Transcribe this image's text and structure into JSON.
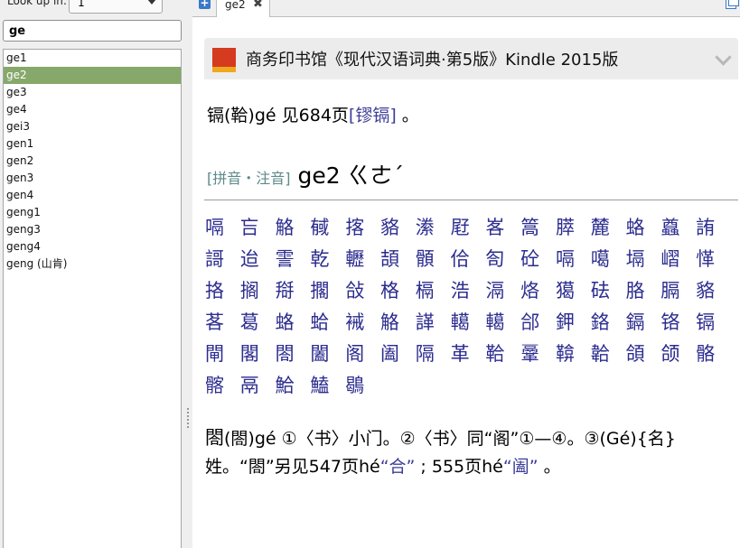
{
  "lookup": {
    "label": "Look up in:",
    "value": "1"
  },
  "search": {
    "value": "ge"
  },
  "words": [
    "ge1",
    "ge2",
    "ge3",
    "ge4",
    "gei3",
    "gen1",
    "gen2",
    "gen3",
    "gen4",
    "geng1",
    "geng3",
    "geng4",
    "geng (山肯)"
  ],
  "selected_index": 1,
  "tab": {
    "label": "ge2",
    "close": "✖"
  },
  "dictionary": {
    "title": "商务印书馆《现代汉语词典·第5版》Kindle 2015版"
  },
  "entry1": {
    "head": "镉",
    "paren": "(鞈)",
    "pinyin": "gé",
    "see": "见684页",
    "ref": "[镠镉]",
    "end": " 。"
  },
  "pinyin_header": {
    "label": "[拼音・注音]",
    "value": " ge2 ㄍㄜˊ"
  },
  "char_rows": [
    [
      "嗝",
      "吂",
      "觡",
      "戫",
      "揢",
      "貉",
      "潫",
      "屘",
      "峉",
      "篙",
      "膵",
      "麓",
      "蛒",
      "蠤",
      "詴"
    ],
    [
      "謌",
      "迨",
      "霅",
      "乾",
      "轣",
      "頡",
      "顝",
      "佮",
      "匌",
      "砼",
      "嗝",
      "噶",
      "塥",
      "嶍",
      "愅"
    ],
    [
      "挌",
      "搁",
      "搿",
      "擱",
      "敆",
      "格",
      "槅",
      "浩",
      "滆",
      "烙",
      "獦",
      "砝",
      "胳",
      "膈",
      "貉"
    ],
    [
      "茖",
      "葛",
      "蛒",
      "蛤",
      "裓",
      "觡",
      "諽",
      "轕",
      "轕",
      "郃",
      "鉀",
      "鉻",
      "鎘",
      "铬",
      "镉"
    ],
    [
      "閘",
      "閣",
      "閤",
      "闔",
      "阁",
      "阖",
      "隔",
      "革",
      "鞈",
      "鞷",
      "鞥",
      "韐",
      "頜",
      "颌",
      "骼"
    ],
    [
      "髂",
      "鬲",
      "鮯",
      "鰪",
      "鶡"
    ]
  ],
  "entry2": {
    "head": "閤",
    "paren": "(閤)",
    "pinyin": "gé",
    "def1": " ①〈书〉小门。②〈书〉同“阁”①—④。③(Gé){名}姓。“閤”另见547页hé",
    "ref1": "“合”",
    "def2": "  ; 555页hé",
    "ref2": "“阖”",
    "end": "  。"
  }
}
